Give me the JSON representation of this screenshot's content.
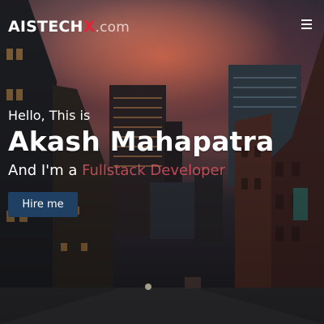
{
  "brand": {
    "main": "AISTECH",
    "accent": "X",
    "tld": ".com"
  },
  "nav": {
    "menu_icon": "hamburger-menu-icon"
  },
  "hero": {
    "greeting": "Hello, This is",
    "name": "Akash Mahapatra",
    "role_prefix": "And I'm a ",
    "role_typed": "Fullstack Developer",
    "cta_label": "Hire me",
    "background": "city-street-sunset-photo"
  },
  "colors": {
    "accent": "#e0263a",
    "button": "#1f3f63",
    "text": "#ffffff"
  }
}
